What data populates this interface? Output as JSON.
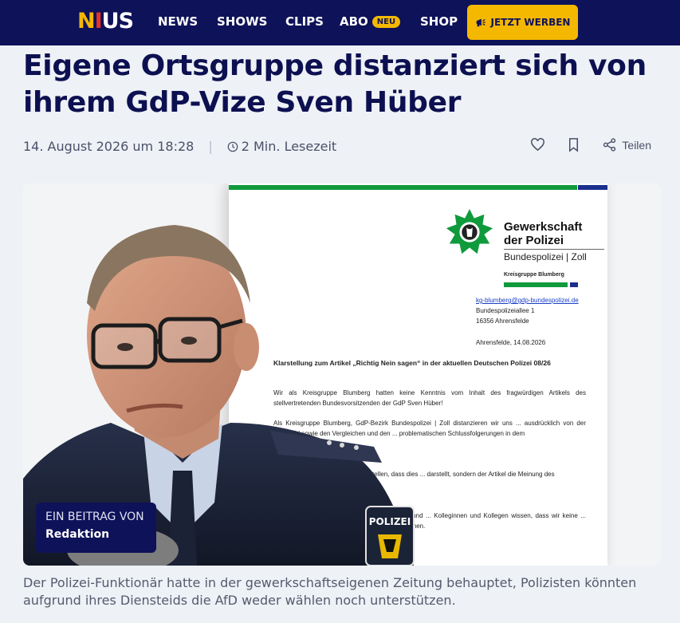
{
  "nav": {
    "logo": "NIUS",
    "links": [
      "NEWS",
      "SHOWS",
      "CLIPS",
      "ABO",
      "SHOP"
    ],
    "abo_badge": "NEU",
    "cta": "JETZT WERBEN"
  },
  "article": {
    "headline": "Eigene Ortsgruppe distanziert sich von ihrem GdP-Vize Sven Hüber",
    "date": "14. August 2026 um 18:28",
    "reading_time": "2 Min. Lesezeit",
    "share_label": "Teilen",
    "byline_label": "EIN BEITRAG VON",
    "byline_name": "Redaktion",
    "caption": "Der Polizei-Funktionär hatte in der gewerkschaftseigenen Zeitung behauptet, Polizisten könnten aufgrund ihres Diensteids die AfD weder wählen noch unterstützen."
  },
  "document": {
    "org_line1": "Gewerkschaft",
    "org_line2": "der Polizei",
    "org_line3": "Bundespolizei | Zoll",
    "kreisgruppe": "Kreisgruppe Blumberg",
    "email": "kg-blumberg@gdp-bundespolizei.de",
    "street": "Bundespolizeiallee 1",
    "city": "16356 Ahrensfelde",
    "date": "Ahrensfelde, 14.08.2026",
    "subject": "Klarstellung zum Artikel „Richtig Nein sagen“ in der aktuellen Deutschen Polizei 08/26",
    "p1": "Wir als Kreisgruppe Blumberg hatten keine Kenntnis vom Inhalt des fragwürdigen Artikels des stellvertretenden Bundesvorsitzenden der GdP Sven Hüber!",
    "p2": "Als Kreisgruppe Blumberg, GdP-Bezirk Bundespolizei | Zoll distanzieren wir uns ... ausdrücklich von der Wortwahl sowie den Vergleichen und den ... problematischen Schlussfolgerungen in dem",
    "p3": "... wollen wir hier noch einmal klarstellen, dass dies ... darstellt, sondern der Artikel die Meinung des",
    "p4": "... selbstverständlich klar, dass wir unparteilich und ... Kolleginnen und Kollegen wissen, dass wir keine ... darüber zu entscheiden, welche politischen ... dienen.",
    "patch": "POLIZEI"
  },
  "colors": {
    "nav_bg": "#0e1259",
    "accent": "#f5b800",
    "gdp_green": "#0f9a3c"
  }
}
